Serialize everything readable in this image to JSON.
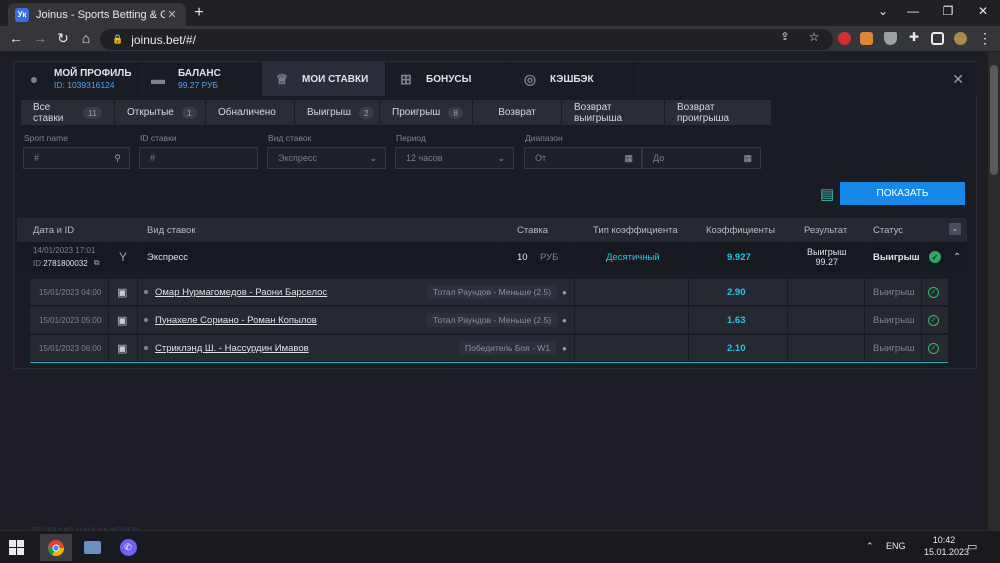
{
  "browser": {
    "tab_title": "Joinus - Sports Betting & Gaming",
    "favicon_text": "Ук",
    "url": "joinus.bet/#/"
  },
  "modal": {
    "tabs": [
      {
        "label": "МОЙ ПРОФИЛЬ",
        "sub": "ID: 1039316124",
        "icon": "user-icon"
      },
      {
        "label": "БАЛАНС",
        "sub": "99.27 РУБ",
        "icon": "wallet-icon"
      },
      {
        "label": "МОИ СТАВКИ",
        "sub": "",
        "icon": "trophy-icon"
      },
      {
        "label": "БОНУСЫ",
        "sub": "",
        "icon": "gift-icon"
      },
      {
        "label": "КЭШБЭК",
        "sub": "",
        "icon": "cashback-icon"
      }
    ],
    "filter_tabs": [
      {
        "label": "Все ставки",
        "count": "11"
      },
      {
        "label": "Открытые",
        "count": "1"
      },
      {
        "label": "Обналичено",
        "count": ""
      },
      {
        "label": "Выигрыш",
        "count": "2"
      },
      {
        "label": "Проигрыш",
        "count": "8"
      },
      {
        "label": "Возврат",
        "count": ""
      },
      {
        "label": "Возврат выигрыша",
        "count": ""
      },
      {
        "label": "Возврат проигрыша",
        "count": ""
      }
    ],
    "fields": {
      "sport_name_label": "Sport name",
      "sport_name_placeholder": "#",
      "bet_id_label": "ID ставки",
      "bet_id_placeholder": "#",
      "bet_type_label": "Вид ставок",
      "bet_type_value": "Экспресс",
      "period_label": "Период",
      "period_value": "12 часов",
      "range_label": "Диапазон",
      "from_placeholder": "От",
      "to_placeholder": "До"
    },
    "show_button": "ПОКАЗАТЬ",
    "table_headers": [
      "Дата и ID",
      "Вид ставок",
      "Ставка",
      "Тип коэффициента",
      "Коэффициенты",
      "Результат",
      "Статус"
    ],
    "bet": {
      "date": "14/01/2023 17:01",
      "id_label": "ID:",
      "id": "2781800032",
      "type": "Экспресс",
      "stake": "10",
      "currency": "РУБ",
      "odds_type": "Десятичный",
      "odds": "9.927",
      "result_label": "Выигрыш",
      "result_value": "99.27",
      "status": "Выигрыш"
    },
    "events": [
      {
        "date": "15/01/2023 04:00",
        "match": "Омар Нурмагомедов - Раони Барселос",
        "market": "Тотал Раундов - Меньше (2.5)",
        "odds": "2.90",
        "status": "Выигрыш"
      },
      {
        "date": "15/01/2023 05:00",
        "match": "Пунахеле Сориано - Роман Копылов",
        "market": "Тотал Раундов - Меньше (2.5)",
        "odds": "1.63",
        "status": "Выигрыш"
      },
      {
        "date": "15/01/2023 06:00",
        "match": "Стриклэнд Ш. - Нассурдин Имавов",
        "market": "Победитель Боя - W1",
        "odds": "2.10",
        "status": "Выигрыш"
      }
    ]
  },
  "background_text": "ЛЕЧЕНИЯ НАЧНИ ИГРАТЬ",
  "taskbar": {
    "lang": "ENG",
    "time": "10:42",
    "date": "15.01.2023"
  }
}
